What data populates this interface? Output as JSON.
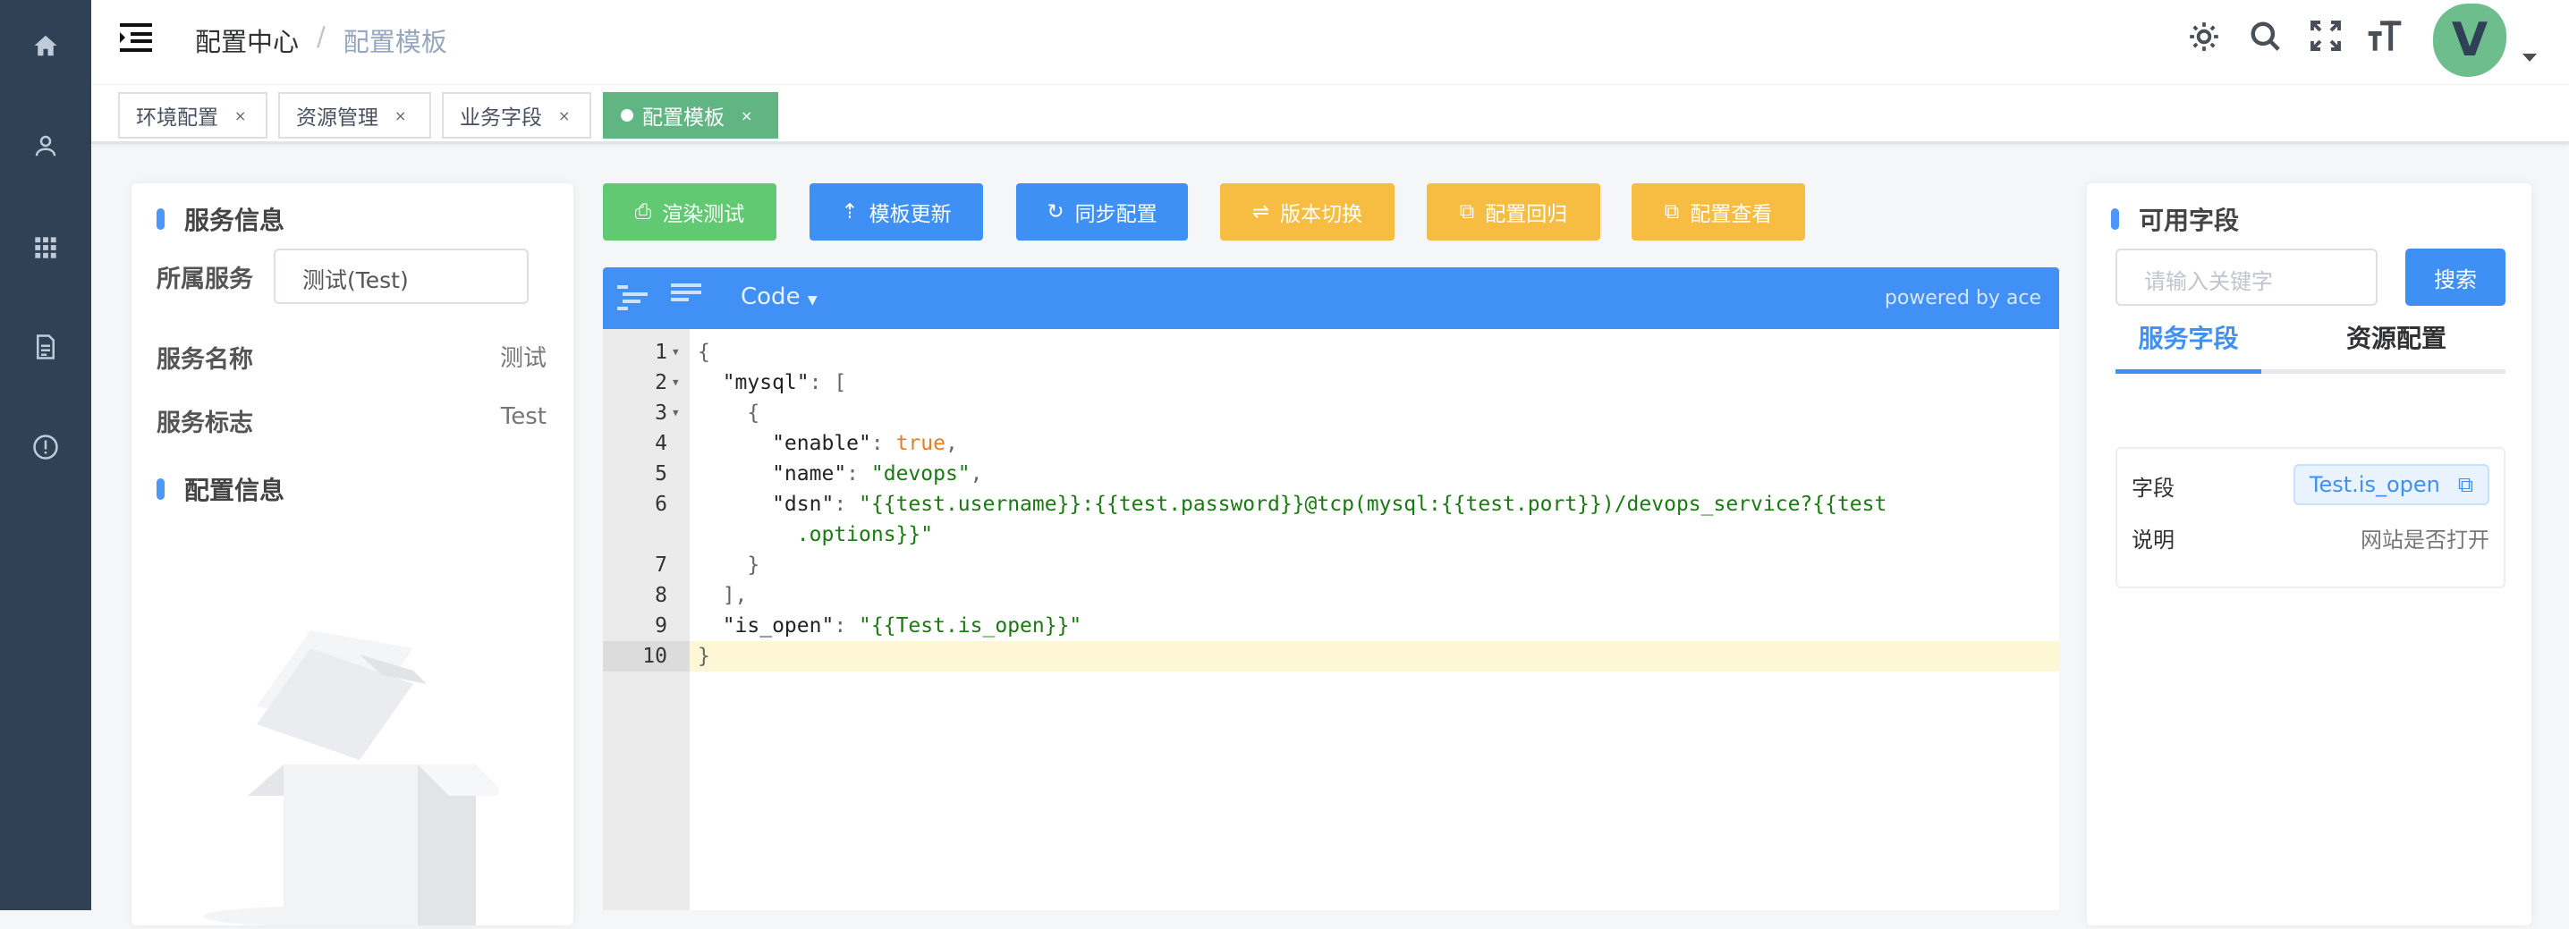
{
  "sidebar": {
    "items": [
      {
        "icon": "home-icon"
      },
      {
        "icon": "user-icon"
      },
      {
        "icon": "grid-icon"
      },
      {
        "icon": "document-icon"
      },
      {
        "icon": "alert-icon"
      }
    ]
  },
  "header": {
    "breadcrumb": [
      "配置中心",
      "配置模板"
    ],
    "separator": "/",
    "avatar_letter": "V",
    "avatar_color": "#6dbd8d"
  },
  "tags": [
    {
      "label": "环境配置",
      "close": "×"
    },
    {
      "label": "资源管理",
      "close": "×"
    },
    {
      "label": "业务字段",
      "close": "×"
    },
    {
      "label": "配置模板",
      "close": "×",
      "active": true
    }
  ],
  "left": {
    "service_title": "服务信息",
    "service_label": "所属服务",
    "service_value": "测试(Test)",
    "name_label": "服务名称",
    "name_value": "测试",
    "flag_label": "服务标志",
    "flag_value": "Test",
    "config_title": "配置信息"
  },
  "toolbar": {
    "render": "渲染测试",
    "update": "模板更新",
    "sync": "同步配置",
    "version": "版本切换",
    "rollback": "配置回归",
    "view": "配置查看"
  },
  "editor": {
    "mode": "Code",
    "powered": "powered by ace",
    "lines": [
      {
        "n": "1",
        "fold": true,
        "parts": [
          [
            "p",
            "{"
          ]
        ]
      },
      {
        "n": "2",
        "fold": true,
        "parts": [
          [
            "",
            "  \"mysql\""
          ],
          [
            "p",
            ": ["
          ]
        ]
      },
      {
        "n": "3",
        "fold": true,
        "parts": [
          [
            "p",
            "    {"
          ]
        ]
      },
      {
        "n": "4",
        "parts": [
          [
            "",
            "      \"enable\""
          ],
          [
            "p",
            ": "
          ],
          [
            "b",
            "true"
          ],
          [
            "p",
            ","
          ]
        ]
      },
      {
        "n": "5",
        "parts": [
          [
            "",
            "      \"name\""
          ],
          [
            "p",
            ": "
          ],
          [
            "s",
            "\"devops\""
          ],
          [
            "p",
            ","
          ]
        ]
      },
      {
        "n": "6",
        "parts": [
          [
            "",
            "      \"dsn\""
          ],
          [
            "p",
            ": "
          ],
          [
            "s",
            "\"{{test.username}}:{{test.password}}@tcp(mysql:{{test.port}})/devops_service?{{test"
          ]
        ]
      },
      {
        "n": "",
        "parts": [
          [
            "s",
            "        .options}}\""
          ]
        ]
      },
      {
        "n": "7",
        "parts": [
          [
            "p",
            "    }"
          ]
        ]
      },
      {
        "n": "8",
        "parts": [
          [
            "p",
            "  ],"
          ]
        ]
      },
      {
        "n": "9",
        "parts": [
          [
            "",
            "  \"is_open\""
          ],
          [
            "p",
            ": "
          ],
          [
            "s",
            "\"{{Test.is_open}}\""
          ]
        ]
      },
      {
        "n": "10",
        "active": true,
        "parts": [
          [
            "p",
            "}"
          ]
        ]
      }
    ]
  },
  "right": {
    "title": "可用字段",
    "search_placeholder": "请输入关键字",
    "search_button": "搜索",
    "tabs": [
      "服务字段",
      "资源配置"
    ],
    "field_label": "字段",
    "field_value": "Test.is_open",
    "desc_label": "说明",
    "desc_value": "网站是否打开"
  }
}
